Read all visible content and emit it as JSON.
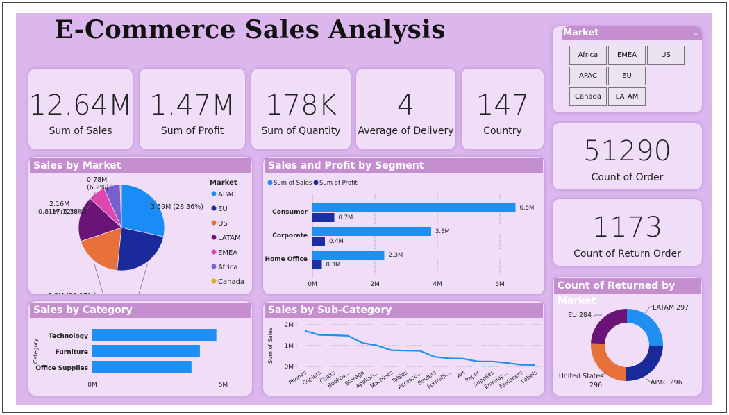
{
  "title": "E-Commerce Sales Analysis",
  "kpis": [
    {
      "value": "12.64M",
      "label": "Sum of Sales"
    },
    {
      "value": "1.47M",
      "label": "Sum of Profit"
    },
    {
      "value": "178K",
      "label": "Sum of Quantity"
    },
    {
      "value": "4",
      "label": "Average of Delivery"
    },
    {
      "value": "147",
      "label": "Country"
    }
  ],
  "kpis_right": [
    {
      "value": "51290",
      "label": "Count of Order"
    },
    {
      "value": "1173",
      "label": "Count of Return Order"
    }
  ],
  "slicer": {
    "title": "Market",
    "chevron": "chevron-down-icon",
    "options": [
      "Africa",
      "EMEA",
      "US",
      "APAC",
      "EU",
      "Canada",
      "LATAM"
    ]
  },
  "colors": {
    "canvas": "#dcb7ee",
    "card": "#f0ddf8",
    "header": "#c58fcf",
    "sales": "#1f8ff2",
    "profit": "#1a2fa3"
  },
  "chart_data": [
    {
      "id": "sales-by-market",
      "type": "pie",
      "title": "Sales by Market",
      "legend_title": "Market",
      "legend_position": "right",
      "slices": [
        {
          "name": "APAC",
          "value": 3.59,
          "label": "3.59M (28.36%)",
          "color": "#1a8cf5"
        },
        {
          "name": "EU",
          "value": 2.94,
          "label": "2.94M (23.24%)",
          "color": "#1a2a9a"
        },
        {
          "name": "US",
          "value": 2.3,
          "label": "2.3M (18.17%)",
          "color": "#e8703a"
        },
        {
          "name": "LATAM",
          "value": 2.16,
          "label": "2.16M (17.12%)",
          "color": "#6b1478"
        },
        {
          "name": "EMEA",
          "value": 0.81,
          "label": "0.81M (6.38%)",
          "color": "#dd46ad"
        },
        {
          "name": "Africa",
          "value": 0.78,
          "label": "0.78M (6.2%)",
          "color": "#7a5fcf"
        },
        {
          "name": "Canada",
          "value": 0.066,
          "label": "",
          "color": "#e0a81c"
        }
      ]
    },
    {
      "id": "sales-profit-by-segment",
      "type": "bar",
      "orientation": "horizontal",
      "title": "Sales and Profit by Segment",
      "legend_position": "top-left",
      "categories": [
        "Consumer",
        "Corporate",
        "Home Office"
      ],
      "series": [
        {
          "name": "Sum of Sales",
          "values": [
            6.5,
            3.8,
            2.3
          ],
          "labels": [
            "6.5M",
            "3.8M",
            "2.3M"
          ],
          "color": "#1f8ff2"
        },
        {
          "name": "Sum of Profit",
          "values": [
            0.7,
            0.4,
            0.3
          ],
          "labels": [
            "0.7M",
            "0.4M",
            "0.3M"
          ],
          "color": "#1a2fa3"
        }
      ],
      "xlim": [
        0,
        7
      ],
      "xticks": [
        0,
        2,
        4,
        6
      ],
      "xtick_labels": [
        "0M",
        "2M",
        "4M",
        "6M"
      ]
    },
    {
      "id": "sales-by-category",
      "type": "bar",
      "orientation": "horizontal",
      "title": "Sales by Category",
      "ylabel": "Category",
      "categories": [
        "Technology",
        "Furniture",
        "Office Supplies"
      ],
      "values": [
        4.74,
        4.11,
        3.79
      ],
      "color": "#1f8ff2",
      "xlim": [
        0,
        5.2
      ],
      "xticks": [
        0,
        5
      ],
      "xtick_labels": [
        "0M",
        "5M"
      ]
    },
    {
      "id": "sales-by-sub-category",
      "type": "line",
      "title": "Sales by Sub-Category",
      "ylabel": "Sum of Sales",
      "categories": [
        "Phones",
        "Copiers",
        "Chairs",
        "Bookca...",
        "Storage",
        "Applian...",
        "Machines",
        "Tables",
        "Accesso...",
        "Binders",
        "Furnishi...",
        "Art",
        "Paper",
        "Supplies",
        "Envelop...",
        "Fasteners",
        "Labels"
      ],
      "values": [
        1.71,
        1.51,
        1.5,
        1.47,
        1.13,
        1.01,
        0.78,
        0.76,
        0.75,
        0.46,
        0.39,
        0.37,
        0.24,
        0.24,
        0.17,
        0.08,
        0.07
      ],
      "color": "#1f8ff2",
      "ylim": [
        0,
        2
      ],
      "yticks": [
        0,
        1,
        2
      ],
      "ytick_labels": [
        "0M",
        "1M",
        "2M"
      ]
    },
    {
      "id": "count-returned-by-market",
      "type": "pie",
      "donut": true,
      "title": "Count of Returned by Market",
      "slices": [
        {
          "name": "LATAM",
          "value": 297,
          "label": "LATAM 297",
          "color": "#1f8ff2"
        },
        {
          "name": "APAC",
          "value": 296,
          "label": "APAC 296",
          "color": "#1a2a9a"
        },
        {
          "name": "United States",
          "value": 296,
          "label_lines": [
            "United States",
            "296"
          ],
          "color": "#e8703a"
        },
        {
          "name": "EU",
          "value": 284,
          "label": "EU 284",
          "color": "#6b1478"
        }
      ]
    }
  ]
}
